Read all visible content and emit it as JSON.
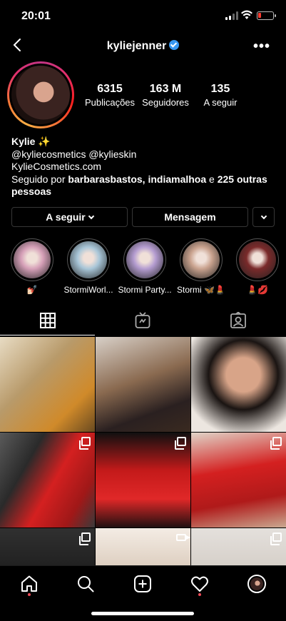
{
  "status_bar": {
    "time": "20:01"
  },
  "header": {
    "username": "kyliejenner",
    "verified": true
  },
  "profile": {
    "stats": [
      {
        "value": "6315",
        "label": "Publicações"
      },
      {
        "value": "163 M",
        "label": "Seguidores"
      },
      {
        "value": "135",
        "label": "A seguir"
      }
    ],
    "name": "Kylie ✨",
    "bio_line1": "@kyliecosmetics @kylieskin",
    "bio_link": "KylieCosmetics.com",
    "followed_by_prefix": "Seguido por ",
    "followed_by_names": "barbarasbastos, indiamalhoa",
    "followed_by_and": " e ",
    "followed_by_others": "225 outras pessoas"
  },
  "actions": {
    "following_label": "A seguir",
    "message_label": "Mensagem"
  },
  "highlights": [
    {
      "caption": "💅🏻",
      "color": "#d6a0b8"
    },
    {
      "caption": "StormiWorl...",
      "color": "#a8c6d8"
    },
    {
      "caption": "Stormi Party...",
      "color": "#b49cd0"
    },
    {
      "caption": "Stormi 🦋💄",
      "color": "#c9a28e"
    },
    {
      "caption": "💄💋",
      "color": "#7a2a2a"
    }
  ],
  "tabs": [
    {
      "name": "grid",
      "active": true
    },
    {
      "name": "igtv",
      "active": false
    },
    {
      "name": "tagged",
      "active": false
    }
  ],
  "posts": [
    {
      "kind": "image",
      "bg": "linear-gradient(135deg,#e8dcc4,#b89a6a 40%,#d08a2a 75%,#6a4a20)"
    },
    {
      "kind": "image",
      "bg": "linear-gradient(160deg,#d8d0c8,#8a6a50 45%,#2a2020 75%,#3a2a20)"
    },
    {
      "kind": "image",
      "bg": "radial-gradient(circle at 55% 40%,#d8a488 0 22%,#1a1412 45%,#ece6e0 80%)"
    },
    {
      "kind": "album",
      "bg": "linear-gradient(120deg,#5a5a5a,#2a2a2a 30%,#d42020 55%,#a01818 80%,#3a3a3a)"
    },
    {
      "kind": "album",
      "bg": "linear-gradient(180deg,#101010,#c41a1a 40%,#e02828 70%,#201010)"
    },
    {
      "kind": "album",
      "bg": "linear-gradient(170deg,#e0d4c8,#d42020 40%,#b01a1a 70%,#caa890)"
    },
    {
      "kind": "album",
      "bg": "linear-gradient(180deg,#303030,#1a1a1a 60%,#0a0a0a)"
    },
    {
      "kind": "video",
      "bg": "linear-gradient(180deg,#f4ece4,#d8c8b8 50%,#2a1e18)"
    },
    {
      "kind": "album",
      "bg": "linear-gradient(180deg,#e4e0dc,#cfc8c0 60%,#3a3030)"
    }
  ],
  "colors": {
    "accent": "#3897f0",
    "notification": "#ed4956",
    "border": "#363636"
  }
}
